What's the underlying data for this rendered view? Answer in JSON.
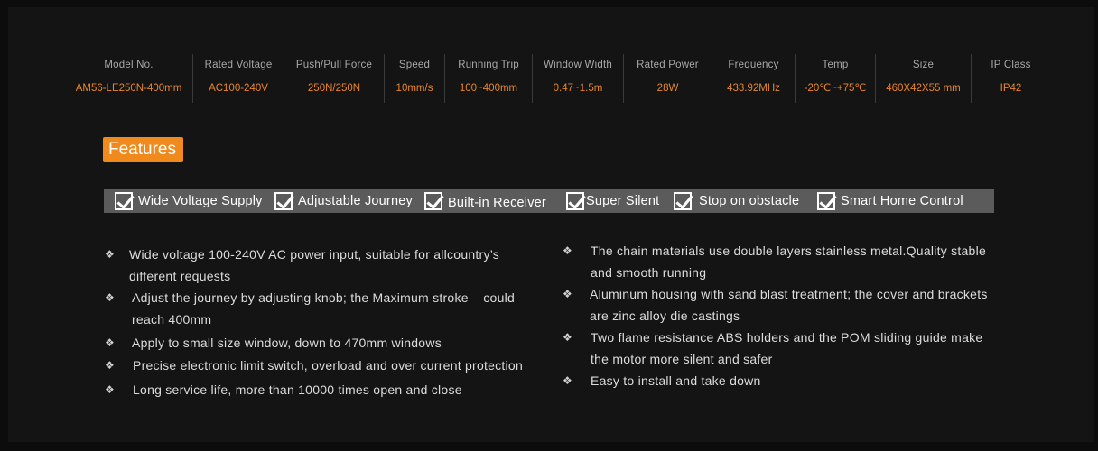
{
  "specs": [
    {
      "label": "Model No.",
      "value": "AM56-LE250N-400mm"
    },
    {
      "label": "Rated Voltage",
      "value": "AC100-240V"
    },
    {
      "label": "Push/Pull Force",
      "value": "250N/250N"
    },
    {
      "label": "Speed",
      "value": "10mm/s"
    },
    {
      "label": "Running Trip",
      "value": "100~400mm"
    },
    {
      "label": "Window Width",
      "value": "0.47~1.5m"
    },
    {
      "label": "Rated Power",
      "value": "28W"
    },
    {
      "label": "Frequency",
      "value": "433.92MHz"
    },
    {
      "label": "Temp",
      "value": "-20℃~+75℃"
    },
    {
      "label": "Size",
      "value": "460X42X55 mm"
    },
    {
      "label": "IP Class",
      "value": "IP42"
    }
  ],
  "features_title": "Features",
  "feature_checks": [
    "Wide Voltage Supply",
    "Adjustable Journey",
    "Built-in Receiver",
    "Super Silent",
    "Stop on obstacle",
    "Smart Home Control"
  ],
  "bullet_symbol": "❖",
  "left_bullets": [
    {
      "line1": "Wide voltage 100-240V AC power input, suitable for allcountry’s",
      "line2": "different requests"
    },
    {
      "line1": "Adjust the journey by adjusting knob; the Maximum stroke    could",
      "line2": "reach 400mm"
    },
    {
      "line1": "Apply to small size window, down to 470mm windows"
    },
    {
      "line1": "Precise electronic limit switch, overload and over current protection"
    },
    {
      "line1": "Long service life, more than 10000 times open and close"
    }
  ],
  "right_bullets": [
    {
      "line1": "The chain materials use double layers stainless metal.Quality stable",
      "line2": "and smooth running"
    },
    {
      "line1": "Aluminum housing with sand blast treatment; the cover and brackets",
      "line2": "are zinc alloy die castings"
    },
    {
      "line1": "Two flame resistance ABS holders and the POM sliding guide make",
      "line2": "the motor more silent and safer"
    },
    {
      "line1": "Easy to install and take down"
    }
  ],
  "colors": {
    "background": "#0c0c0c",
    "panel": "#141414",
    "accent": "#f08a1c",
    "spec_value": "#e8862a",
    "feature_bar": "#5b5b5b"
  }
}
